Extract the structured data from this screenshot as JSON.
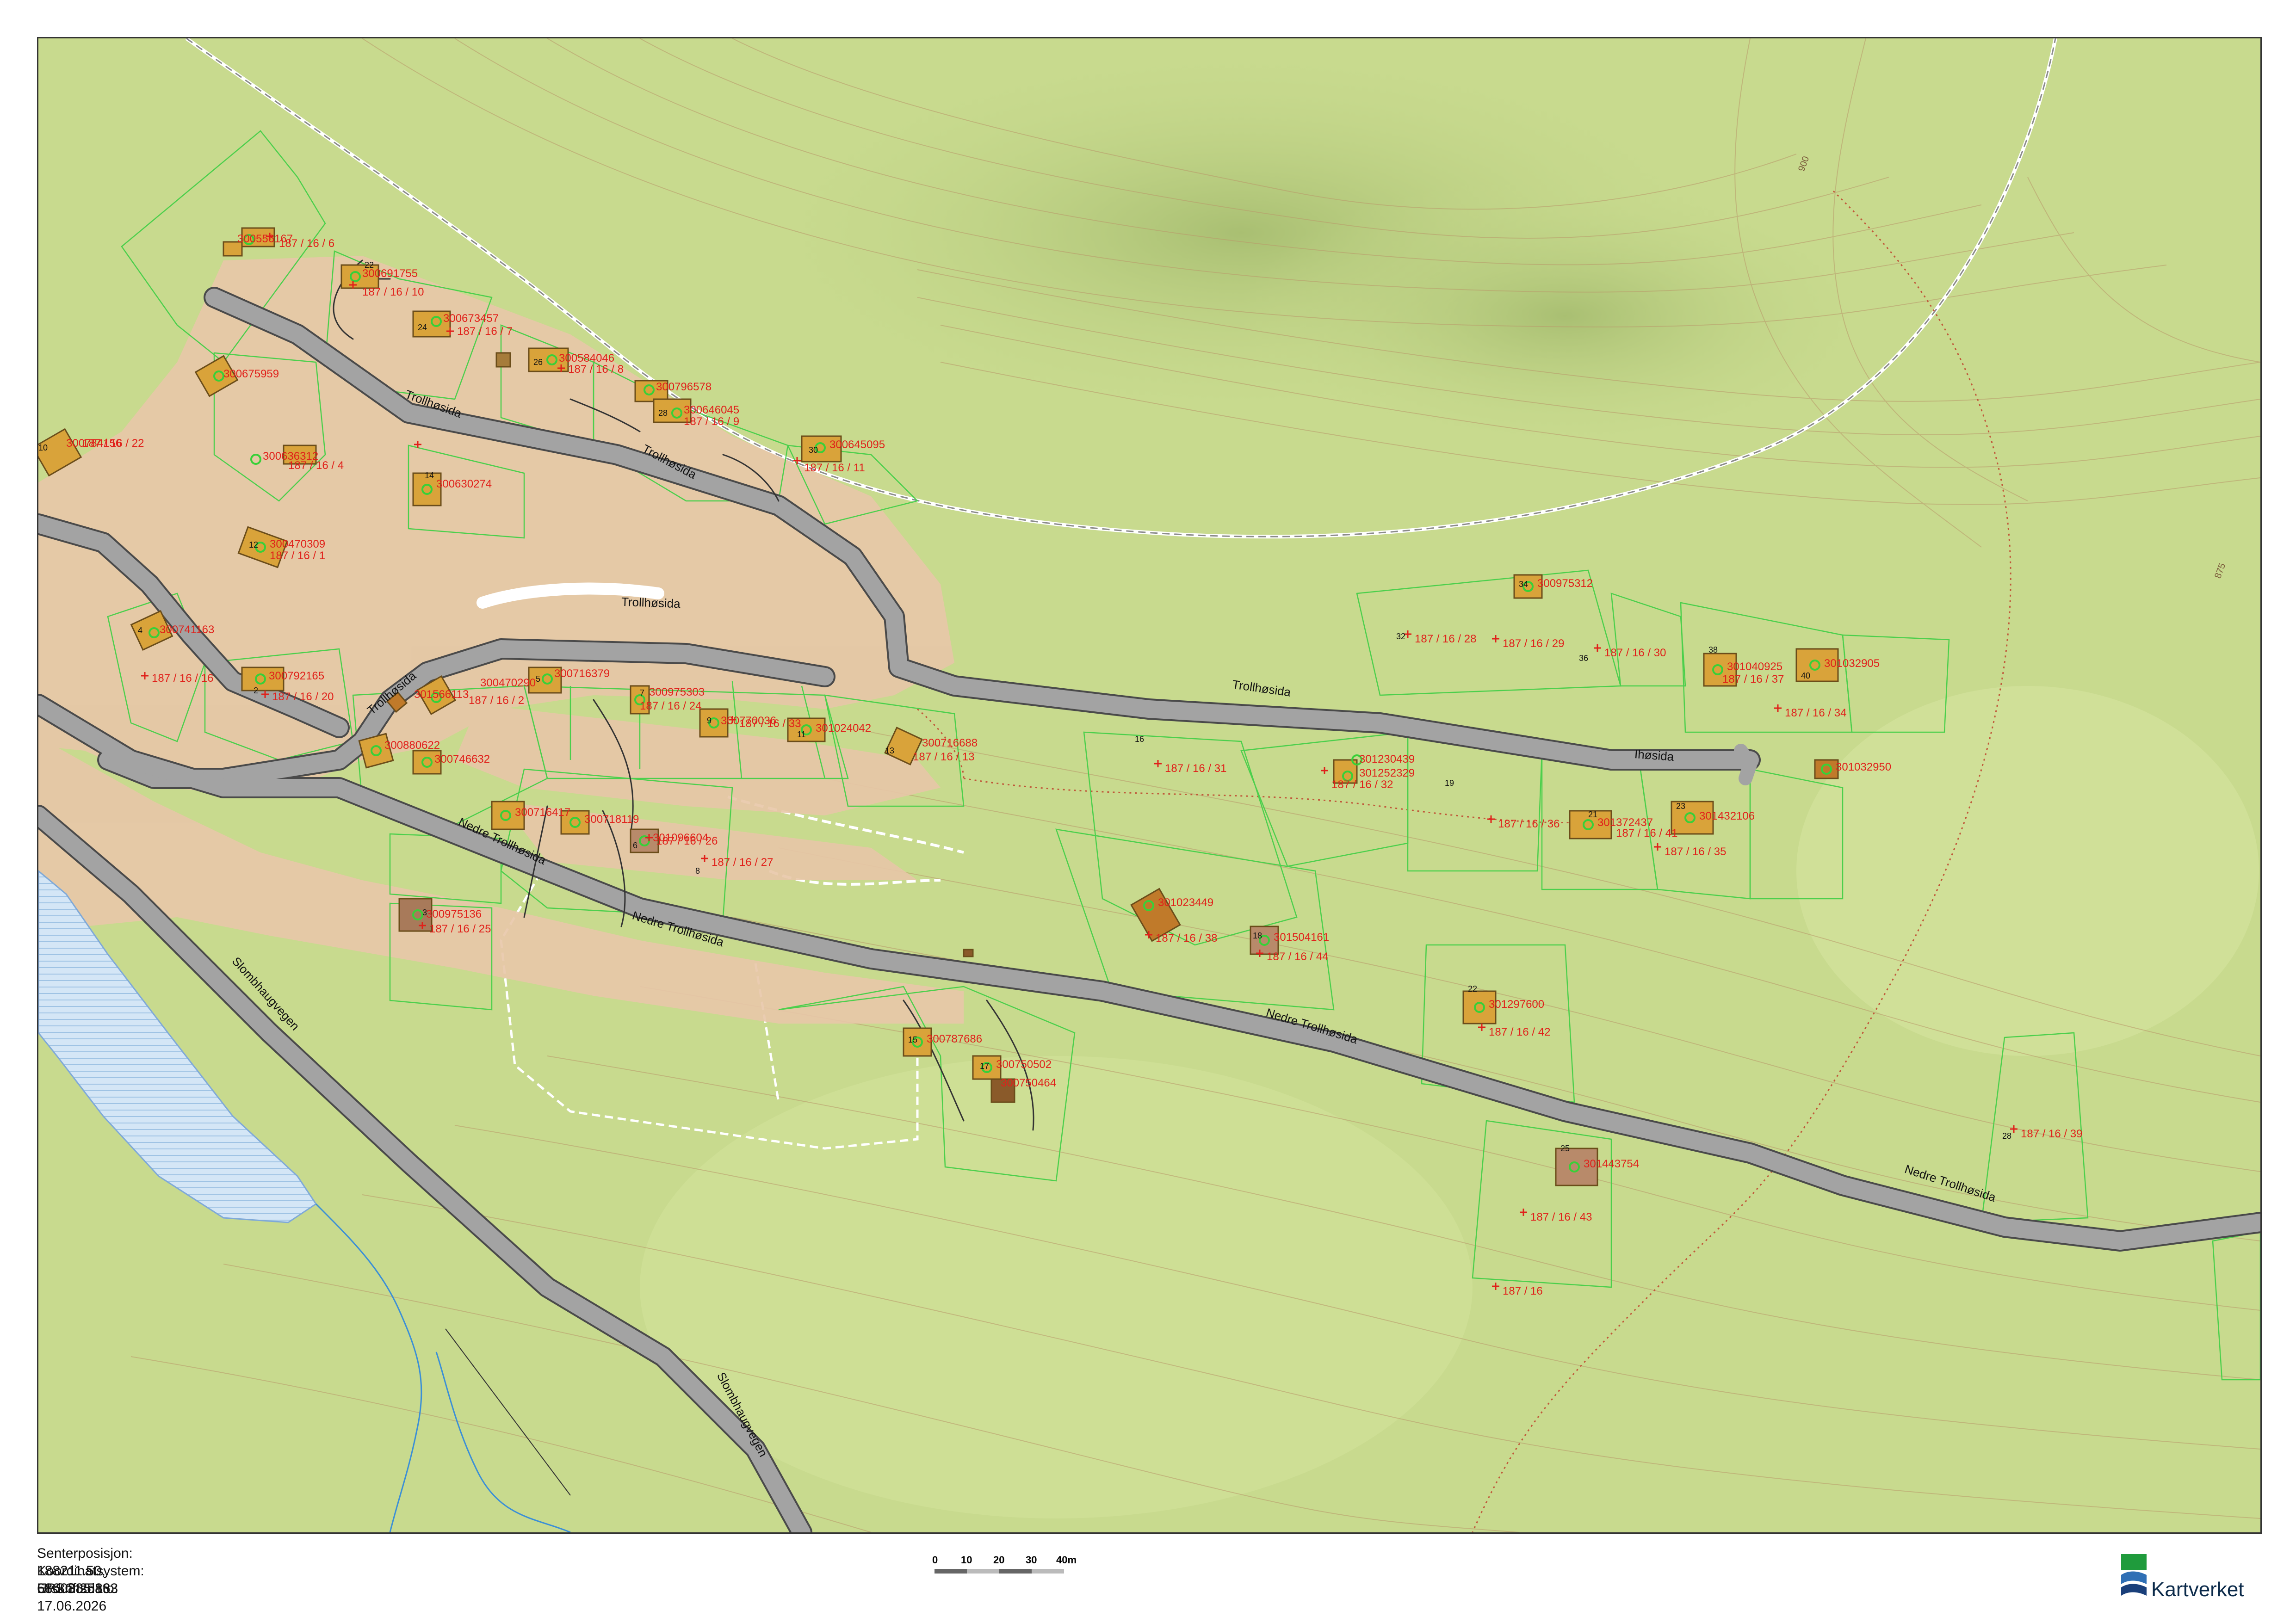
{
  "map": {
    "roads": [
      "Trollhøsida",
      "Trollhøsida",
      "Trollhøsida",
      "Trollhøsida",
      "Trollhøsida",
      "Ihøsida",
      "Nedre Trollhøsida",
      "Nedre Trollhøsida",
      "Nedre Trollhøsida",
      "Slombhaugvegen",
      "Slombhaugvegen"
    ],
    "contours": [
      "900",
      "875"
    ],
    "building_ids": [
      "300556167",
      "300691755",
      "300673457",
      "300584046",
      "300796578",
      "300646045",
      "300645095",
      "300675959",
      "300784156",
      "300636312",
      "300630274",
      "300470309",
      "300741163",
      "300792165",
      "301566113",
      "300470290",
      "300716379",
      "300975303",
      "300770036",
      "301024042",
      "300716688",
      "300880622",
      "300746632",
      "300716417",
      "300718119",
      "301096604",
      "300975136",
      "300787686",
      "300750502",
      "300750464",
      "301023449",
      "301504161",
      "301230439",
      "301252329",
      "300975312",
      "301040925",
      "301032905",
      "301032950",
      "301372437",
      "301432106",
      "301297600",
      "301443754"
    ],
    "parcels": [
      "187 / 16 / 6",
      "187 / 16 / 10",
      "187 / 16 / 7",
      "187 / 16 / 8",
      "187 / 16 / 9",
      "187 / 16 / 11",
      "187 / 16 / 22",
      "187 / 16 / 4",
      "187 / 16 / 1",
      "187 / 16 / 16",
      "187 / 16 / 20",
      "187 / 16 / 2",
      "187 / 16 / 24",
      "187 / 16 / 33",
      "187 / 16 / 13",
      "187 / 16 / 26",
      "187 / 16 / 27",
      "187 / 16 / 25",
      "187 / 16 / 38",
      "187 / 16 / 44",
      "187 / 16 / 31",
      "187 / 16 / 32",
      "187 / 16 / 28",
      "187 / 16 / 29",
      "187 / 16 / 30",
      "187 / 16 / 37",
      "187 / 16 / 34",
      "187 / 16 / 36",
      "187 / 16 / 41",
      "187 / 16 / 35",
      "187 / 16 / 42",
      "187 / 16 / 43",
      "187 / 16",
      "187 / 16 / 39"
    ],
    "house_numbers": [
      "22",
      "24",
      "26",
      "28",
      "30",
      "10",
      "14",
      "12",
      "4",
      "2",
      "7",
      "5",
      "9",
      "11",
      "13",
      "3",
      "6",
      "8",
      "15",
      "17",
      "18",
      "16",
      "19",
      "32",
      "34",
      "36",
      "38",
      "40",
      "21",
      "23",
      "22",
      "25",
      "28"
    ]
  },
  "footer": {
    "center_label": "Senterposisjon:",
    "center_value": "188211.50, 6860885.16",
    "crs_label": "Koordinatsystem:",
    "crs_value": "EPSG:25833",
    "date_label": "Utskriftsdato:",
    "date_value": "17.06.2026"
  },
  "scale": {
    "ticks": [
      "0",
      "10",
      "20",
      "30",
      "40m"
    ]
  },
  "logo": {
    "name": "Kartverket"
  },
  "colors": {
    "terrain": "#c8da8e",
    "residential": "#e8c7a8",
    "road": "#9a9a9a",
    "building": "#d9a33a",
    "parcel_line": "#4ccf4c",
    "label": "#e0201a",
    "water": "#d2e4f4"
  }
}
